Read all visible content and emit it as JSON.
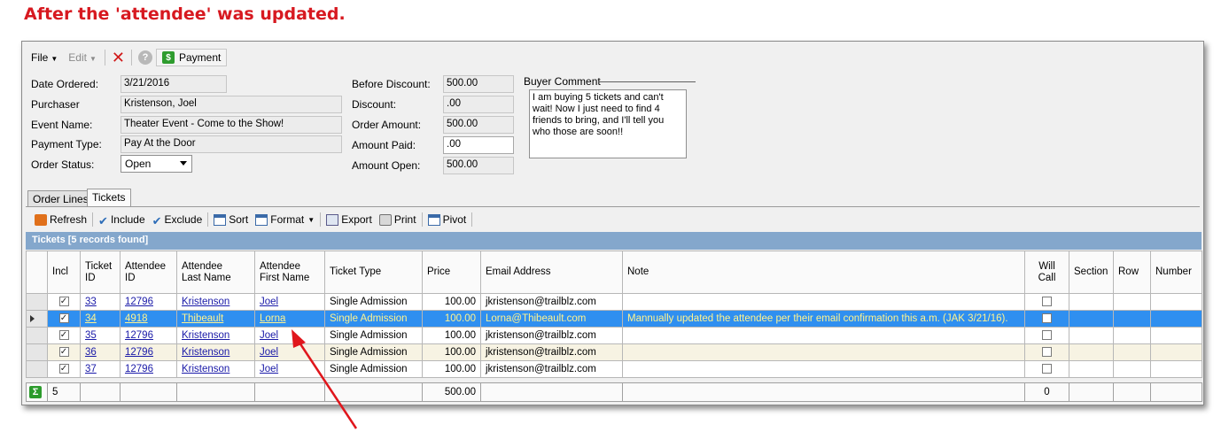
{
  "headline": "After the 'attendee' was updated.",
  "menubar": {
    "file": "File",
    "edit": "Edit",
    "payment": "Payment"
  },
  "form": {
    "date_ordered_label": "Date Ordered:",
    "date_ordered": "3/21/2016",
    "purchaser_label": "Purchaser",
    "purchaser": "Kristenson, Joel",
    "event_label": "Event Name:",
    "event": "Theater Event - Come to the Show!",
    "payment_type_label": "Payment Type:",
    "payment_type": "Pay At the Door",
    "order_status_label": "Order Status:",
    "order_status": "Open",
    "before_discount_label": "Before Discount:",
    "before_discount": "500.00",
    "discount_label": "Discount:",
    "discount": ".00",
    "order_amount_label": "Order Amount:",
    "order_amount": "500.00",
    "amount_paid_label": "Amount Paid:",
    "amount_paid": ".00",
    "amount_open_label": "Amount Open:",
    "amount_open": "500.00",
    "buyer_comment_label": "Buyer Comment",
    "buyer_comment": "I am buying 5 tickets and can't wait!  Now I just need to find 4 friends to bring, and I'll tell you who those are soon!!"
  },
  "tabs": {
    "order_lines": "Order Lines",
    "tickets": "Tickets"
  },
  "toolbar": {
    "refresh": "Refresh",
    "include": "Include",
    "exclude": "Exclude",
    "sort": "Sort",
    "format": "Format",
    "export": "Export",
    "print": "Print",
    "pivot": "Pivot"
  },
  "grid": {
    "title": "Tickets [5 records found]",
    "columns": {
      "incl": "Incl",
      "ticket_id_1": "Ticket",
      "ticket_id_2": "ID",
      "attendee_id_1": "Attendee",
      "attendee_id_2": "ID",
      "last_1": "Attendee",
      "last_2": "Last Name",
      "first_1": "Attendee",
      "first_2": "First Name",
      "ticket_type": "Ticket Type",
      "price": "Price",
      "email": "Email Address",
      "note": "Note",
      "will_call_1": "Will",
      "will_call_2": "Call",
      "section": "Section",
      "row": "Row",
      "number": "Number"
    },
    "rows": [
      {
        "ticket_id": "33",
        "attendee_id": "12796",
        "last": "Kristenson",
        "first": "Joel",
        "type": "Single Admission",
        "price": "100.00",
        "email": "jkristenson@trailblz.com",
        "note": ""
      },
      {
        "ticket_id": "34",
        "attendee_id": "4918",
        "last": "Thibeault",
        "first": "Lorna",
        "type": "Single Admission",
        "price": "100.00",
        "email": "Lorna@Thibeault.com",
        "note": "Mannually updated the attendee per their email confirmation this a.m. (JAK 3/21/16)."
      },
      {
        "ticket_id": "35",
        "attendee_id": "12796",
        "last": "Kristenson",
        "first": "Joel",
        "type": "Single Admission",
        "price": "100.00",
        "email": "jkristenson@trailblz.com",
        "note": ""
      },
      {
        "ticket_id": "36",
        "attendee_id": "12796",
        "last": "Kristenson",
        "first": "Joel",
        "type": "Single Admission",
        "price": "100.00",
        "email": "jkristenson@trailblz.com",
        "note": ""
      },
      {
        "ticket_id": "37",
        "attendee_id": "12796",
        "last": "Kristenson",
        "first": "Joel",
        "type": "Single Admission",
        "price": "100.00",
        "email": "jkristenson@trailblz.com",
        "note": ""
      }
    ],
    "summary": {
      "count": "5",
      "price_total": "500.00",
      "will_call_total": "0"
    }
  },
  "colors": {
    "selected_row": "#2f8ff0",
    "header_bar": "#84a7cc",
    "headline": "#d71920",
    "annotation_arrow": "#e0161c"
  }
}
